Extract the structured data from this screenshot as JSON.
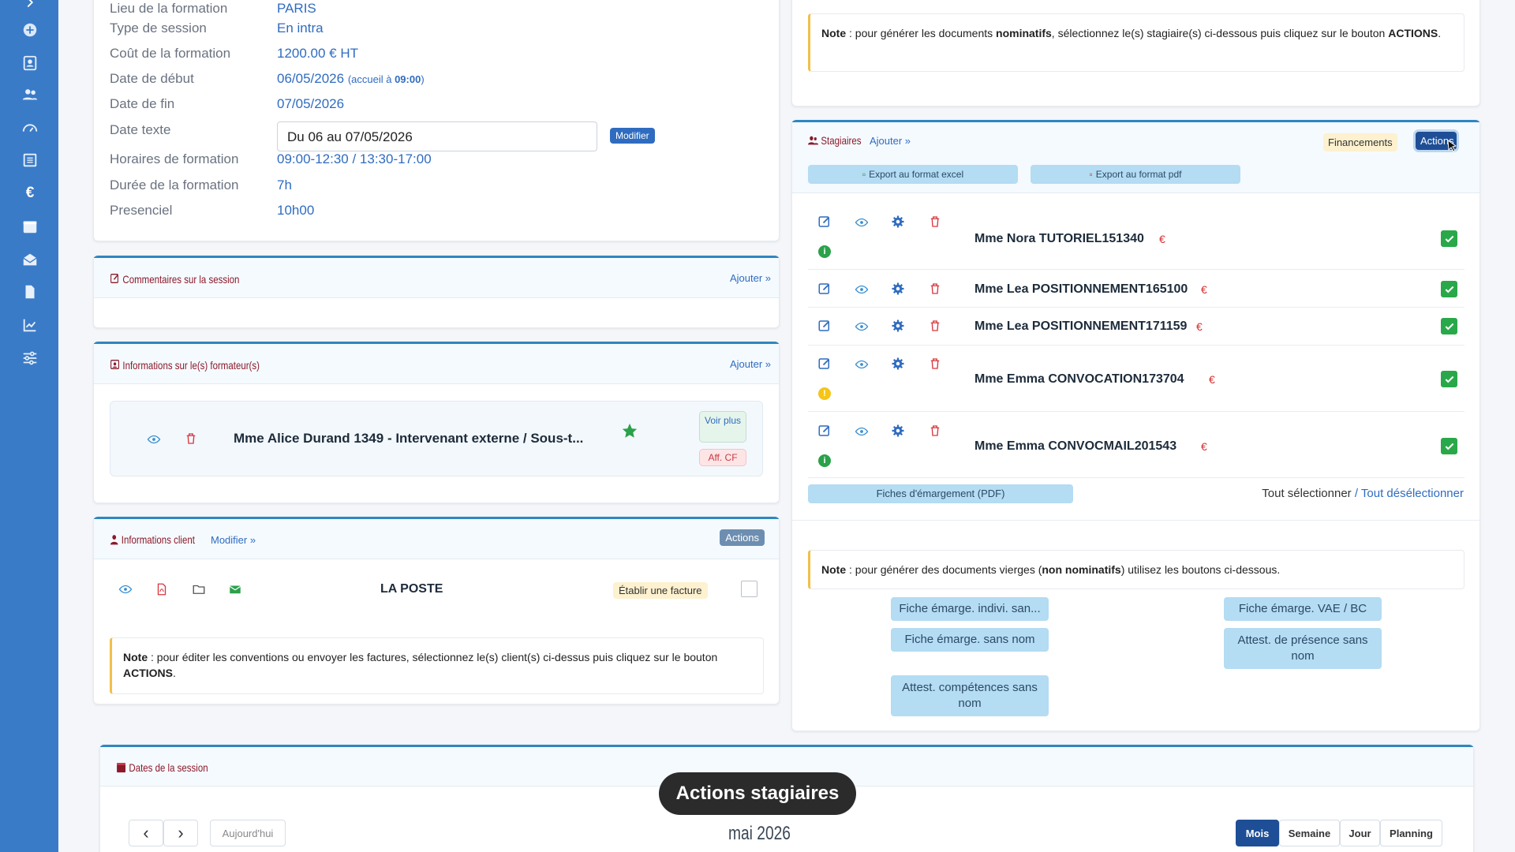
{
  "session_info": {
    "rows": [
      {
        "label": "Lieu de la formation",
        "value": "PARIS"
      },
      {
        "label": "Type de session",
        "value": "En intra"
      },
      {
        "label": "Coût de la formation",
        "value": "1200.00 € HT"
      },
      {
        "label": "Date de début",
        "value": "06/05/2026",
        "extra_prefix": "(accueil à ",
        "extra_bold": "09:00",
        "extra_suffix": ")"
      },
      {
        "label": "Date de fin",
        "value": "07/05/2026"
      },
      {
        "label": "Date texte",
        "input_value": "Du 06 au 07/05/2026",
        "button": "Modifier"
      },
      {
        "label": "Horaires de formation",
        "value": "09:00-12:30 / 13:30-17:00"
      },
      {
        "label": "Durée de la formation",
        "value": "7h"
      },
      {
        "label": "Presenciel",
        "value": "10h00"
      }
    ]
  },
  "commentaires": {
    "title": "Commentaires sur la session",
    "add": "Ajouter »"
  },
  "formateurs": {
    "title": "Informations sur le(s) formateur(s)",
    "add": "Ajouter »",
    "trainer_name": "Mme Alice Durand 1349 - Intervenant externe / Sous-t...",
    "voir_plus": "Voir plus",
    "aff_cf": "Aff. CF"
  },
  "client": {
    "title": "Informations client",
    "modify": "Modifier »",
    "actions": "Actions",
    "name": "LA POSTE",
    "invoice_button": "Établir une facture",
    "note_label": "Note",
    "note_text": " : pour éditer les conventions ou envoyer les factures, sélectionnez le(s) client(s) ci-dessus puis cliquez sur le bouton ",
    "note_bold": "ACTIONS",
    "note_end": "."
  },
  "top_note": {
    "label": "Note",
    "p1": " : pour générer les documents ",
    "bold1": "nominatifs",
    "p2": ", sélectionnez le(s) stagiaire(s) ci-dessous puis cliquez sur le bouton ",
    "bold2": "ACTIONS",
    "p3": "."
  },
  "stagiaires": {
    "title": "Stagiaires",
    "add": "Ajouter »",
    "financements": "Financements",
    "actions": "Actions",
    "export_excel": "Export au format excel",
    "export_pdf": "Export au format pdf",
    "euro": "€",
    "list": [
      {
        "name": "Mme Nora TUTORIEL151340",
        "status": "green"
      },
      {
        "name": "Mme Lea POSITIONNEMENT165100",
        "status": ""
      },
      {
        "name": "Mme Lea POSITIONNEMENT171159",
        "status": ""
      },
      {
        "name": "Mme Emma CONVOCATION173704",
        "status": "yellow"
      },
      {
        "name": "Mme Emma CONVOCMAIL201543",
        "status": "green"
      }
    ],
    "fiches_pdf": "Fiches d'émargement (PDF)",
    "select_all": "Tout sélectionner",
    "separator": " / ",
    "deselect_all": "Tout désélectionner"
  },
  "blank_docs": {
    "note_label": "Note",
    "p1": " : pour générer des documents vierges (",
    "bold": "non nominatifs",
    "p2": ") utilisez les boutons ci-dessous.",
    "buttons": {
      "b1": "Fiche émarge. indivi. san...",
      "b2": "Fiche émarge. VAE / BC",
      "b3": "Fiche émarge. sans nom",
      "b4": "Attest. de présence sans nom",
      "b5": "Attest. compétences sans nom"
    }
  },
  "dates": {
    "title": "Dates de la session",
    "prev": "‹",
    "next": "›",
    "today": "Aujourd'hui",
    "month_label": "mai 2026",
    "views": {
      "mois": "Mois",
      "semaine": "Semaine",
      "jour": "Jour",
      "planning": "Planning"
    }
  },
  "tooltip": "Actions stagiaires",
  "colors": {
    "sidebar": "#3a7bc8",
    "accent": "#2f6cc0",
    "title_red": "#8b1a2a",
    "check_green": "#29a84a",
    "delete_red": "#d9363e",
    "pill_blue": "#b4dcf3"
  }
}
